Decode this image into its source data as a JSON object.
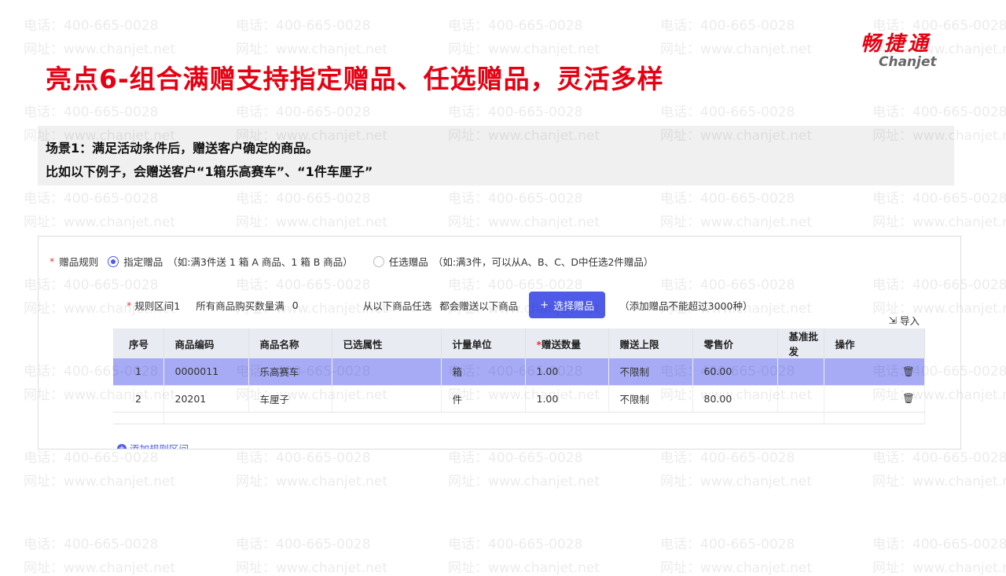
{
  "watermark": {
    "phone": "电话：400-665-0028",
    "site": "网址：www.chanjet.net"
  },
  "title": "亮点6-组合满赠支持指定赠品、任选赠品，灵活多样",
  "logo": {
    "cn": "畅捷通",
    "en": "Chanjet"
  },
  "scene": {
    "line1_label": "场景1：",
    "line1_text": "满足活动条件后，赠送客户确定的商品。",
    "line2": "比如以下例子，会赠送客户“1箱乐高赛车”、“1件车厘子”"
  },
  "form": {
    "rule_label": "赠品规则",
    "option1": "指定赠品",
    "option1_hint": "（如:满3件送 1 箱 A 商品、1 箱 B 商品）",
    "option2": "任选赠品",
    "option2_hint": "（如:满3件，可以从A、B、C、D中任选2件赠品）",
    "interval_label": "规则区间1",
    "qty_label": "所有商品购买数量满",
    "qty_value": "0",
    "pick_label": "从以下商品任选",
    "pick_value": "都会赠送以下商品",
    "select_button": "选择赠品",
    "limit_hint": "（添加赠品不能超过3000种）",
    "import": "导入",
    "add_interval": "添加规则区间"
  },
  "table": {
    "headers": [
      "序号",
      "商品编码",
      "商品名称",
      "已选属性",
      "计量单位",
      "赠送数量",
      "赠送上限",
      "零售价",
      "基准批发",
      "操作"
    ],
    "rows": [
      [
        "1",
        "0000011",
        "乐高赛车",
        "",
        "箱",
        "1.00",
        "不限制",
        "60.00",
        ""
      ],
      [
        "2",
        "20201",
        "车厘子",
        "",
        "件",
        "1.00",
        "不限制",
        "80.00",
        ""
      ]
    ]
  },
  "colors": {
    "accent": "#4e5be8",
    "brand": "#e60012",
    "selected_row": "#a7abf6"
  }
}
